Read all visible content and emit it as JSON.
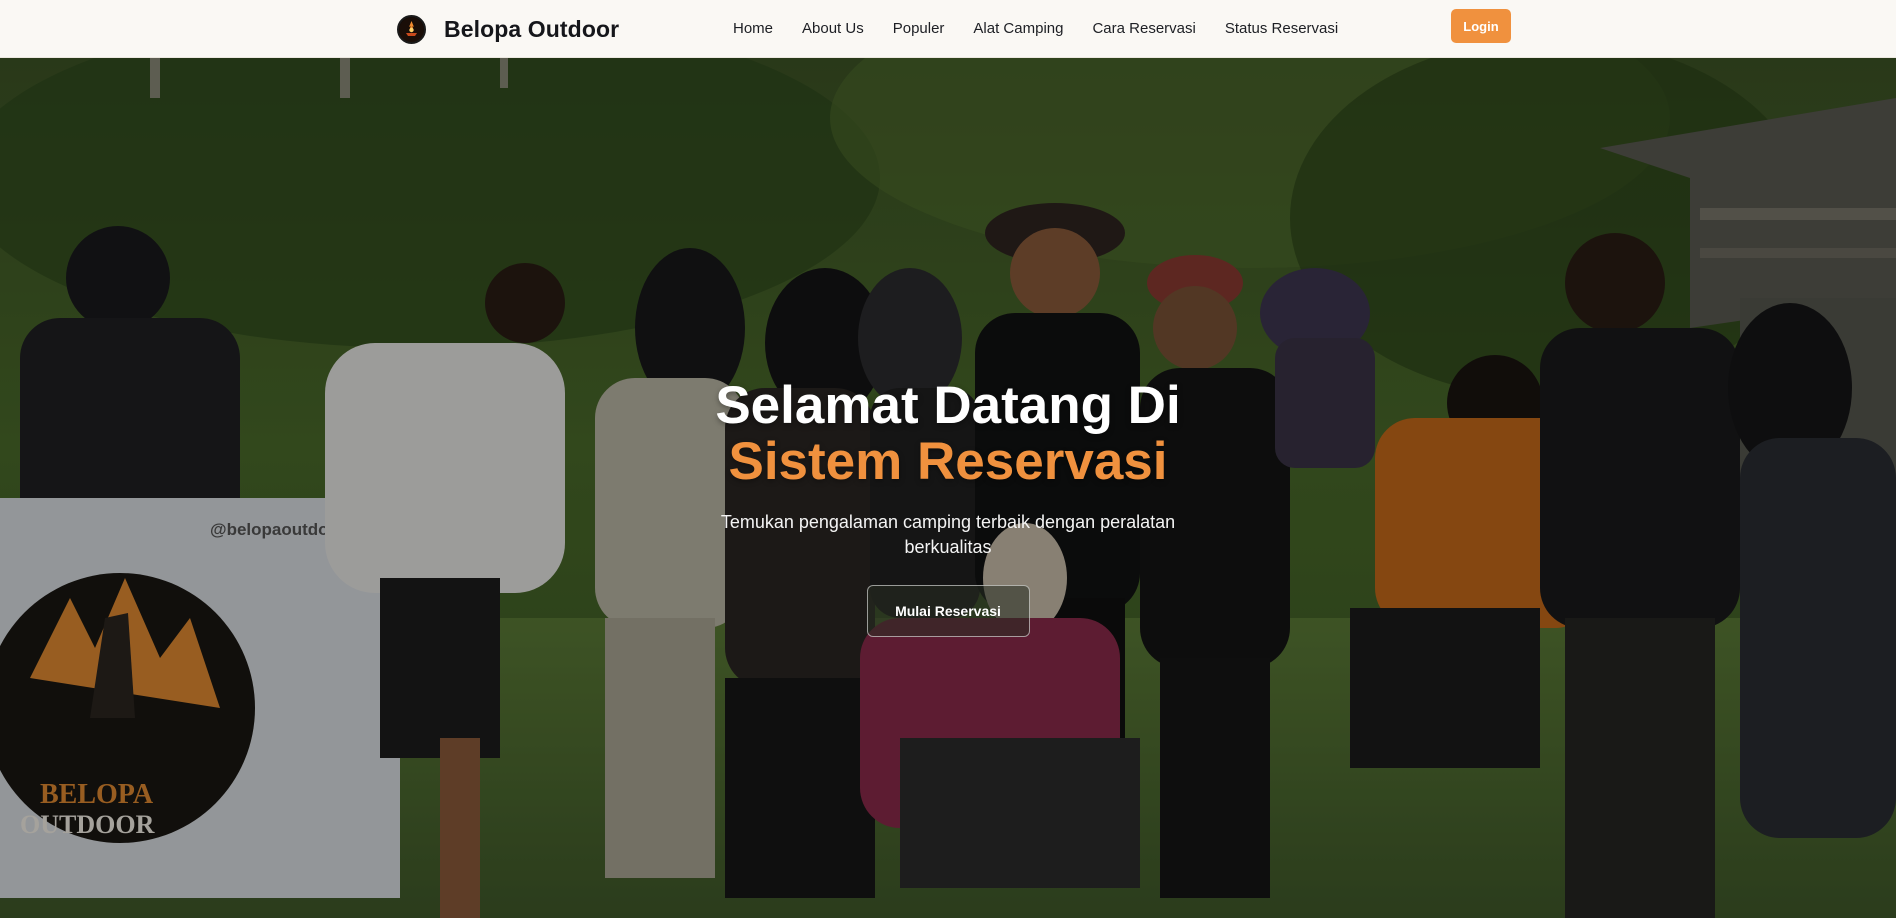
{
  "brand": {
    "name": "Belopa Outdoor",
    "logo_icon": "campfire-logo-icon"
  },
  "nav": {
    "links": [
      {
        "label": "Home"
      },
      {
        "label": "About Us"
      },
      {
        "label": "Populer"
      },
      {
        "label": "Alat Camping"
      },
      {
        "label": "Cara Reservasi"
      },
      {
        "label": "Status Reservasi"
      }
    ],
    "login_label": "Login"
  },
  "hero": {
    "title_line1": "Selamat Datang Di",
    "title_line2": "Sistem Reservasi",
    "subtitle": "Temukan pengalaman camping terbaik dengan peralatan berkualitas",
    "cta_label": "Mulai Reservasi",
    "banner_text": "@belopaoutdoor",
    "banner_logo_text_1": "BELOPA",
    "banner_logo_text_2": "OUTDOOR"
  },
  "colors": {
    "accent": "#f0913e",
    "navbar_bg": "#faf8f4",
    "text_dark": "#15161a"
  }
}
